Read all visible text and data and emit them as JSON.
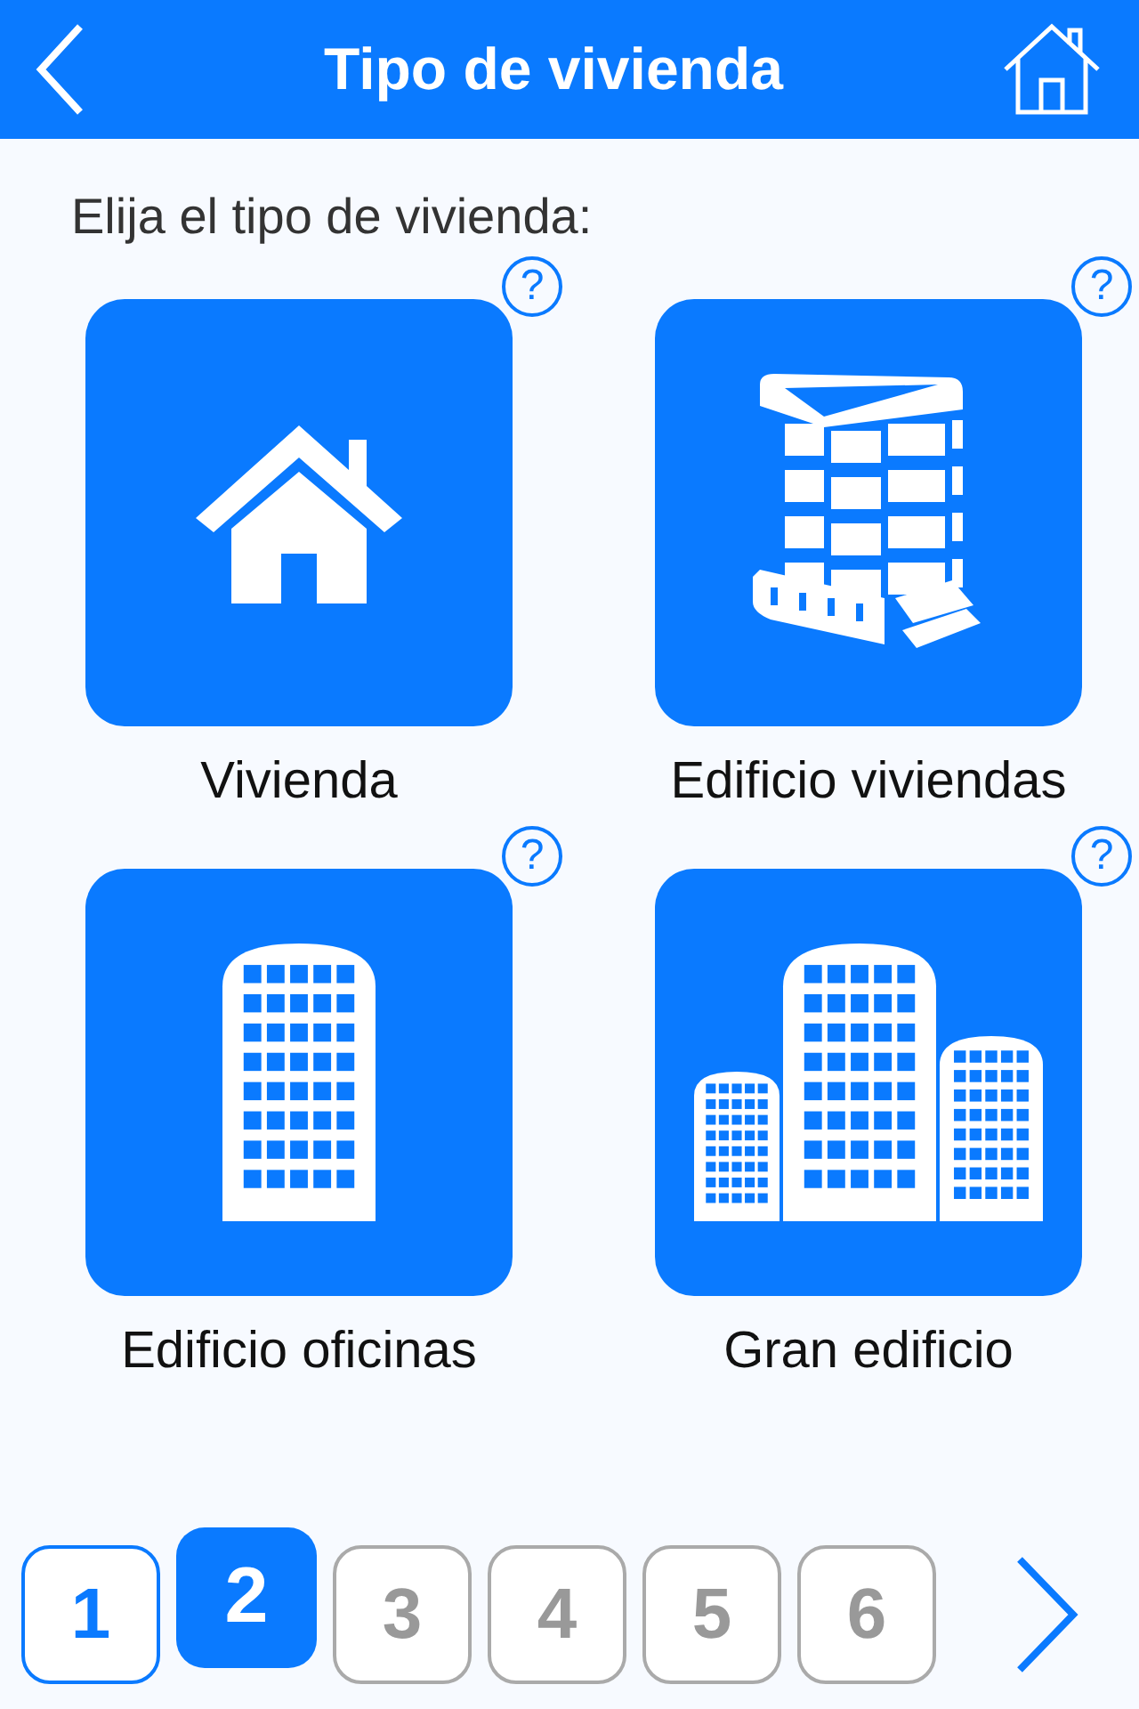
{
  "header": {
    "title": "Tipo de vivienda"
  },
  "prompt": "Elija el tipo de vivienda:",
  "options": [
    {
      "kind": "house",
      "label": "Vivienda",
      "help": "?"
    },
    {
      "kind": "apartment",
      "label": "Edificio viviendas",
      "help": "?"
    },
    {
      "kind": "tower",
      "label": "Edificio oficinas",
      "help": "?"
    },
    {
      "kind": "city",
      "label": "Gran edificio",
      "help": "?"
    }
  ],
  "steps": [
    {
      "label": "1",
      "selected": false,
      "completed": true
    },
    {
      "label": "2",
      "selected": true,
      "completed": false
    },
    {
      "label": "3",
      "selected": false,
      "completed": false
    },
    {
      "label": "4",
      "selected": false,
      "completed": false
    },
    {
      "label": "5",
      "selected": false,
      "completed": false
    },
    {
      "label": "6",
      "selected": false,
      "completed": false
    }
  ]
}
